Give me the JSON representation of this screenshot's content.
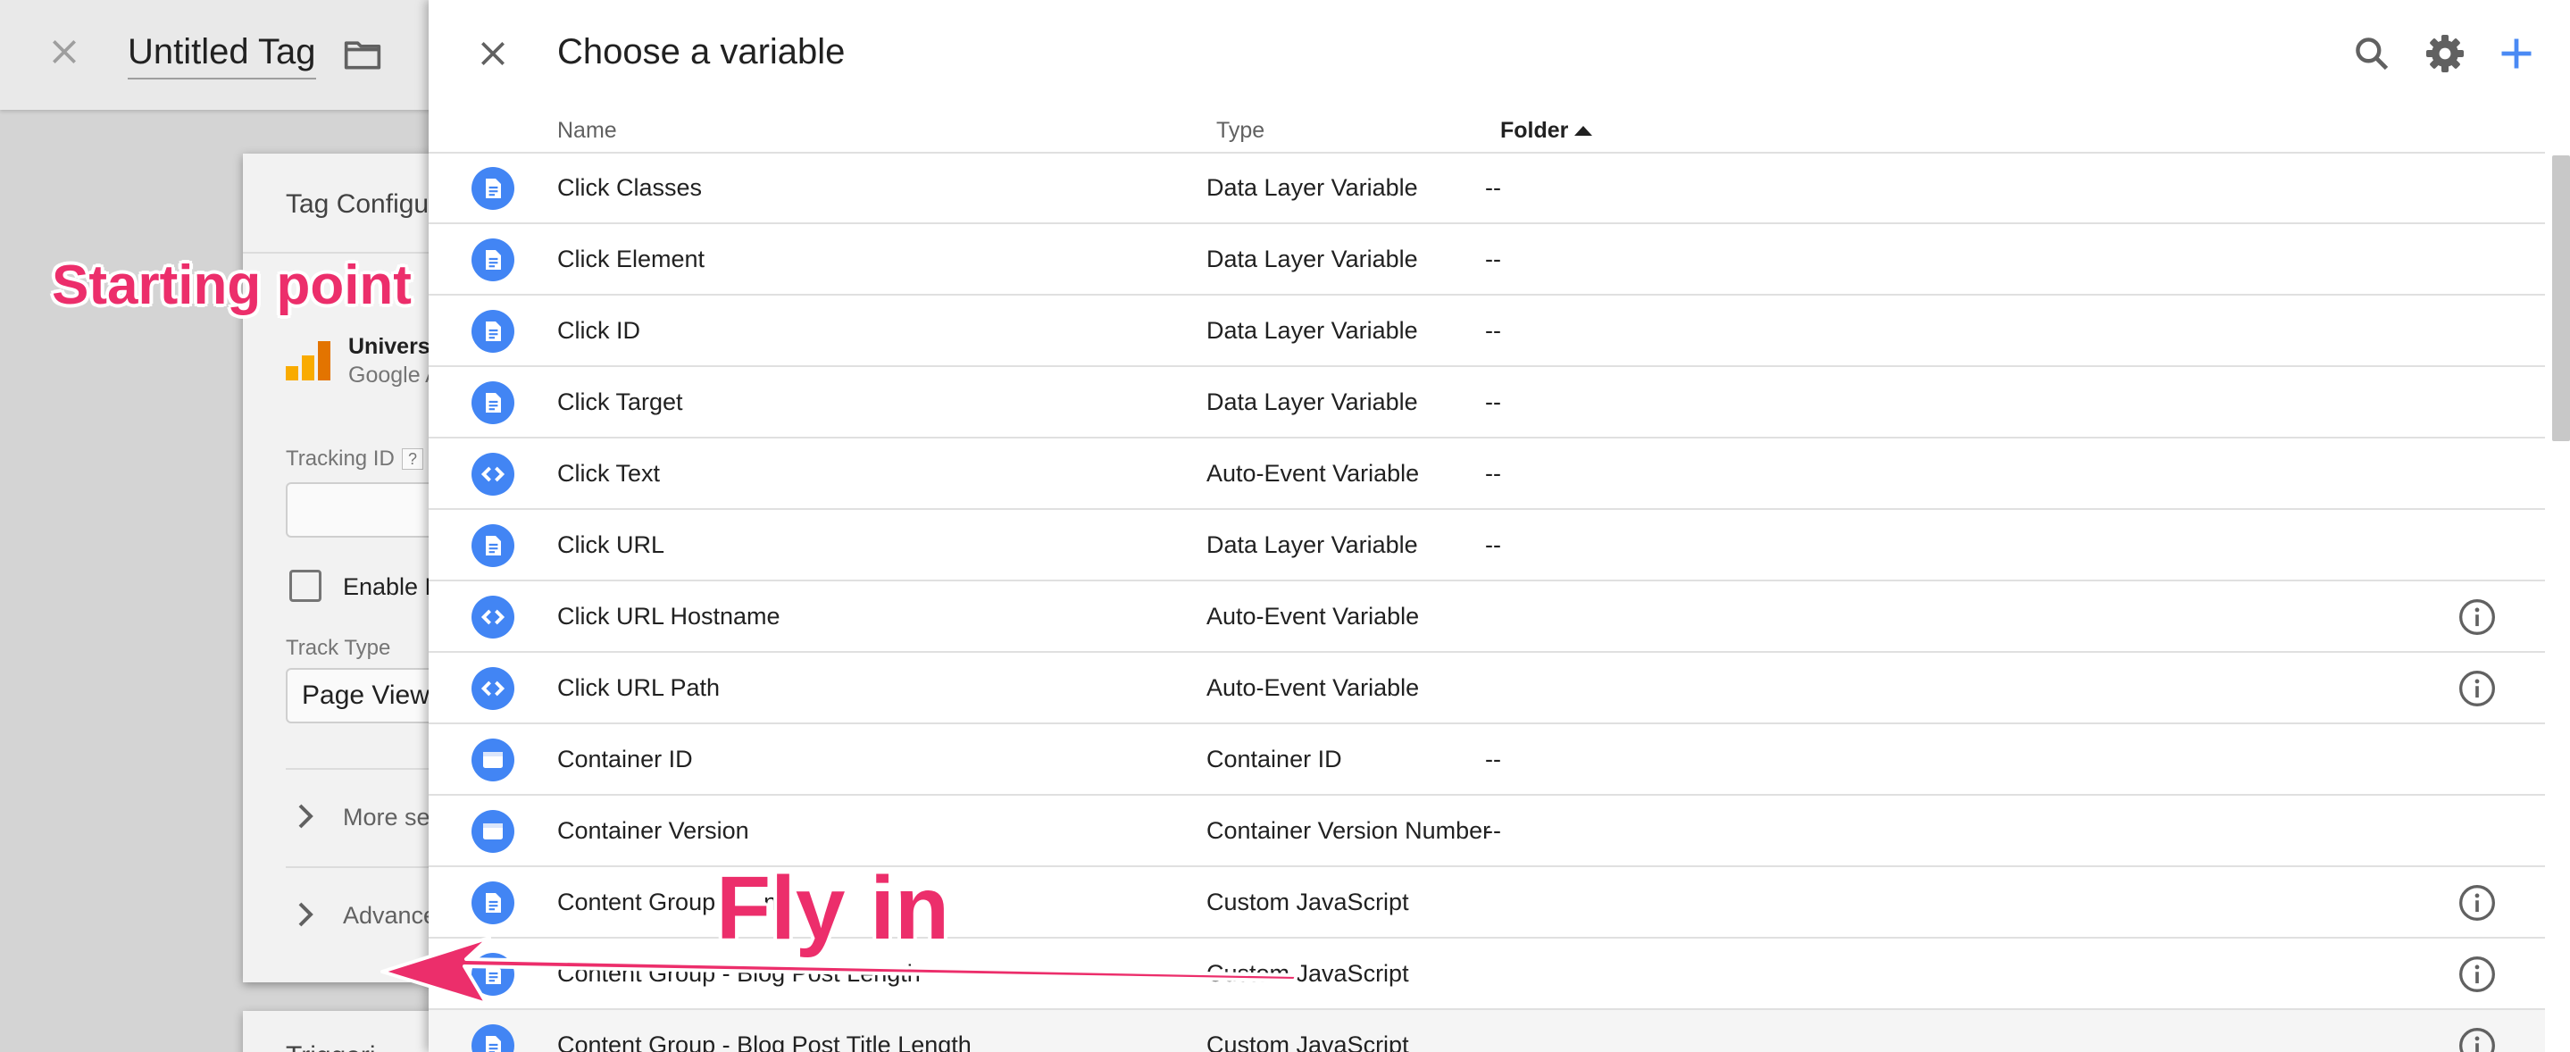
{
  "tag_editor": {
    "title": "Untitled Tag",
    "card_title": "Tag Configu",
    "tag_type_name": "Univers",
    "tag_type_sub": "Google A",
    "tracking_id_label": "Tracking ID",
    "tracking_id_help": "?",
    "tracking_id_value": "",
    "debug_label": "Enable D",
    "track_type_label": "Track Type",
    "track_type_value": "Page View",
    "more_settings_label": "More se",
    "advanced_label": "Advance",
    "triggering_label": "Triggeri"
  },
  "chooser": {
    "title": "Choose a variable",
    "columns": {
      "name": "Name",
      "type": "Type",
      "folder": "Folder"
    },
    "sort": {
      "column": "Folder",
      "direction": "ascending"
    },
    "rows": [
      {
        "name": "Click Classes",
        "type": "Data Layer Variable",
        "folder": "--",
        "icon": "data-layer-icon",
        "info": false
      },
      {
        "name": "Click Element",
        "type": "Data Layer Variable",
        "folder": "--",
        "icon": "data-layer-icon",
        "info": false
      },
      {
        "name": "Click ID",
        "type": "Data Layer Variable",
        "folder": "--",
        "icon": "data-layer-icon",
        "info": false
      },
      {
        "name": "Click Target",
        "type": "Data Layer Variable",
        "folder": "--",
        "icon": "data-layer-icon",
        "info": false
      },
      {
        "name": "Click Text",
        "type": "Auto-Event Variable",
        "folder": "--",
        "icon": "auto-event-icon",
        "info": false
      },
      {
        "name": "Click URL",
        "type": "Data Layer Variable",
        "folder": "--",
        "icon": "data-layer-icon",
        "info": false
      },
      {
        "name": "Click URL Hostname",
        "type": "Auto-Event Variable",
        "folder": "",
        "icon": "auto-event-icon",
        "info": true
      },
      {
        "name": "Click URL Path",
        "type": "Auto-Event Variable",
        "folder": "",
        "icon": "auto-event-icon",
        "info": true
      },
      {
        "name": "Container ID",
        "type": "Container ID",
        "folder": "--",
        "icon": "container-icon",
        "info": false
      },
      {
        "name": "Container Version",
        "type": "Container Version Number",
        "folder": "--",
        "icon": "container-icon",
        "info": false
      },
      {
        "name": "Content Group - ... na",
        "type": "Custom JavaScript",
        "folder": "",
        "icon": "data-layer-icon",
        "info": true
      },
      {
        "name": "Content Group - Blog Post Length",
        "type": "Custom JavaScript",
        "folder": "",
        "icon": "data-layer-icon",
        "info": true
      },
      {
        "name": "Content Group - Blog Post Title Length",
        "type": "Custom JavaScript",
        "folder": "",
        "icon": "data-layer-icon",
        "info": true,
        "highlight": true
      }
    ]
  },
  "annotations": {
    "starting_point": "Starting point",
    "fly_in": "Fly in"
  },
  "colors": {
    "accent_blue": "#4285f4",
    "add_blue": "#4a8af4",
    "annotation_pink": "#ec2e6b",
    "analytics_orange": "#f9ab00",
    "analytics_dark_orange": "#e37400"
  }
}
